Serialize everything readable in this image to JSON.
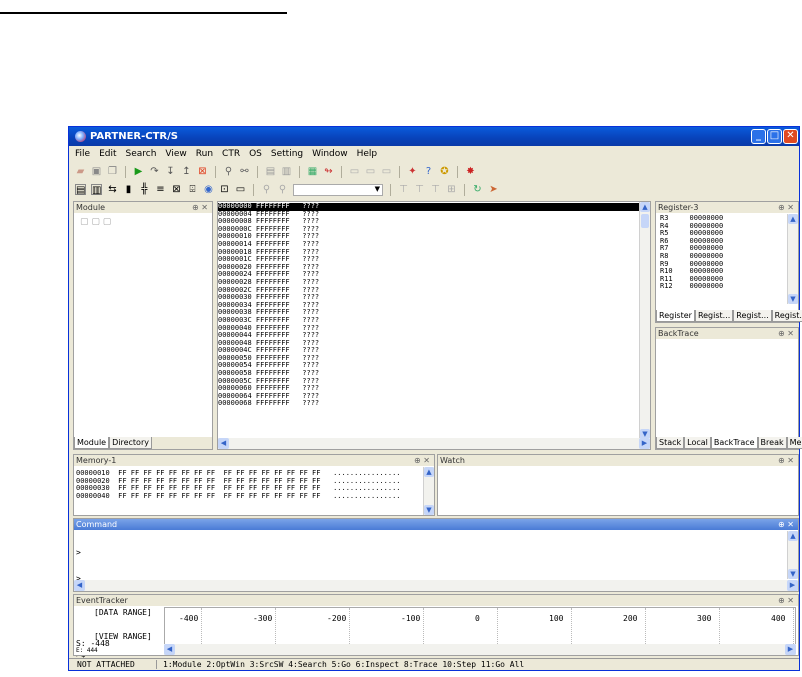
{
  "window": {
    "title": "PARTNER-CTR/S",
    "min": "_",
    "max": "□",
    "close": "✕"
  },
  "menu": [
    "File",
    "Edit",
    "Search",
    "View",
    "Run",
    "CTR",
    "OS",
    "Setting",
    "Window",
    "Help"
  ],
  "panes": {
    "module": {
      "title": "Module",
      "tabs": [
        "Module",
        "Directory"
      ]
    },
    "register": {
      "title": "Register-3",
      "rows": [
        [
          "R3",
          "00000000"
        ],
        [
          "R4",
          "00000000"
        ],
        [
          "R5",
          "00000000"
        ],
        [
          "R6",
          "00000000"
        ],
        [
          "R7",
          "00000000"
        ],
        [
          "R8",
          "00000000"
        ],
        [
          "R9",
          "00000000"
        ],
        [
          "R10",
          "00000000"
        ],
        [
          "R11",
          "00000000"
        ],
        [
          "R12",
          "00000000"
        ]
      ],
      "tabs": [
        "Register",
        "Regist...",
        "Regist...",
        "Regist..."
      ]
    },
    "backtrace": {
      "title": "BackTrace",
      "tabs": [
        "Stack",
        "Local",
        "BackTrace",
        "Break",
        "Memo"
      ]
    },
    "memory": {
      "title": "Memory-1",
      "rows": [
        [
          "00000010",
          "FF FF FF FF FF FF FF FF",
          "FF FF FF FF FF FF FF FF",
          "................"
        ],
        [
          "00000020",
          "FF FF FF FF FF FF FF FF",
          "FF FF FF FF FF FF FF FF",
          "................"
        ],
        [
          "00000030",
          "FF FF FF FF FF FF FF FF",
          "FF FF FF FF FF FF FF FF",
          "................"
        ],
        [
          "00000040",
          "FF FF FF FF FF FF FF FF",
          "FF FF FF FF FF FF FF FF",
          "................"
        ]
      ]
    },
    "watch": {
      "title": "Watch"
    },
    "command": {
      "title": "Command",
      "lines": [
        ">",
        ">",
        ">",
        ">",
        ">$"
      ]
    },
    "eventtracker": {
      "title": "EventTracker",
      "data_range": "[DATA RANGE]",
      "view_range": "[VIEW RANGE]",
      "s_value": "S: -448",
      "e_value": "E: 444",
      "ticks": [
        "-400",
        "-300",
        "-200",
        "-100",
        "0",
        "100",
        "200",
        "300",
        "400"
      ]
    }
  },
  "code": {
    "rows": [
      [
        "00000000",
        "FFFFFFFF",
        "????"
      ],
      [
        "00000004",
        "FFFFFFFF",
        "????"
      ],
      [
        "00000008",
        "FFFFFFFF",
        "????"
      ],
      [
        "0000000C",
        "FFFFFFFF",
        "????"
      ],
      [
        "00000010",
        "FFFFFFFF",
        "????"
      ],
      [
        "00000014",
        "FFFFFFFF",
        "????"
      ],
      [
        "00000018",
        "FFFFFFFF",
        "????"
      ],
      [
        "0000001C",
        "FFFFFFFF",
        "????"
      ],
      [
        "00000020",
        "FFFFFFFF",
        "????"
      ],
      [
        "00000024",
        "FFFFFFFF",
        "????"
      ],
      [
        "00000028",
        "FFFFFFFF",
        "????"
      ],
      [
        "0000002C",
        "FFFFFFFF",
        "????"
      ],
      [
        "00000030",
        "FFFFFFFF",
        "????"
      ],
      [
        "00000034",
        "FFFFFFFF",
        "????"
      ],
      [
        "00000038",
        "FFFFFFFF",
        "????"
      ],
      [
        "0000003C",
        "FFFFFFFF",
        "????"
      ],
      [
        "00000040",
        "FFFFFFFF",
        "????"
      ],
      [
        "00000044",
        "FFFFFFFF",
        "????"
      ],
      [
        "00000048",
        "FFFFFFFF",
        "????"
      ],
      [
        "0000004C",
        "FFFFFFFF",
        "????"
      ],
      [
        "00000050",
        "FFFFFFFF",
        "????"
      ],
      [
        "00000054",
        "FFFFFFFF",
        "????"
      ],
      [
        "00000058",
        "FFFFFFFF",
        "????"
      ],
      [
        "0000005C",
        "FFFFFFFF",
        "????"
      ],
      [
        "00000060",
        "FFFFFFFF",
        "????"
      ],
      [
        "00000064",
        "FFFFFFFF",
        "????"
      ],
      [
        "00000068",
        "FFFFFFFF",
        "????"
      ]
    ]
  },
  "status": {
    "left": "NOT ATTACHED",
    "keys": "1:Module 2:OptWin 3:SrcSW 4:Search 5:Go 6:Inspect 8:Trace 10:Step 11:Go All"
  },
  "toolbar1": [
    "open-icon",
    "save-icon",
    "copy-icon",
    "run-icon",
    "step-over-icon",
    "step-in-icon",
    "step-out-icon",
    "stop-icon",
    "find-icon",
    "find-next-icon",
    "paste-icon",
    "clip-icon",
    "grid-icon",
    "jump-icon",
    "pane1-icon",
    "pane2-icon",
    "pane3-icon",
    "rocket-icon",
    "help-icon",
    "about-icon",
    "bug-icon"
  ],
  "toolbar2": [
    "src-icon",
    "mix-icon",
    "asm-icon",
    "bp-icon",
    "trace-icon",
    "mem-icon",
    "watch-icon",
    "local-icon",
    "stack-icon",
    "reg-icon",
    "cmd-icon",
    "find2-icon",
    "find3-icon",
    "dropdown-icon",
    "filter1-icon",
    "filter2-icon",
    "filter3-icon",
    "filter4-icon",
    "refresh-icon",
    "go-icon"
  ]
}
